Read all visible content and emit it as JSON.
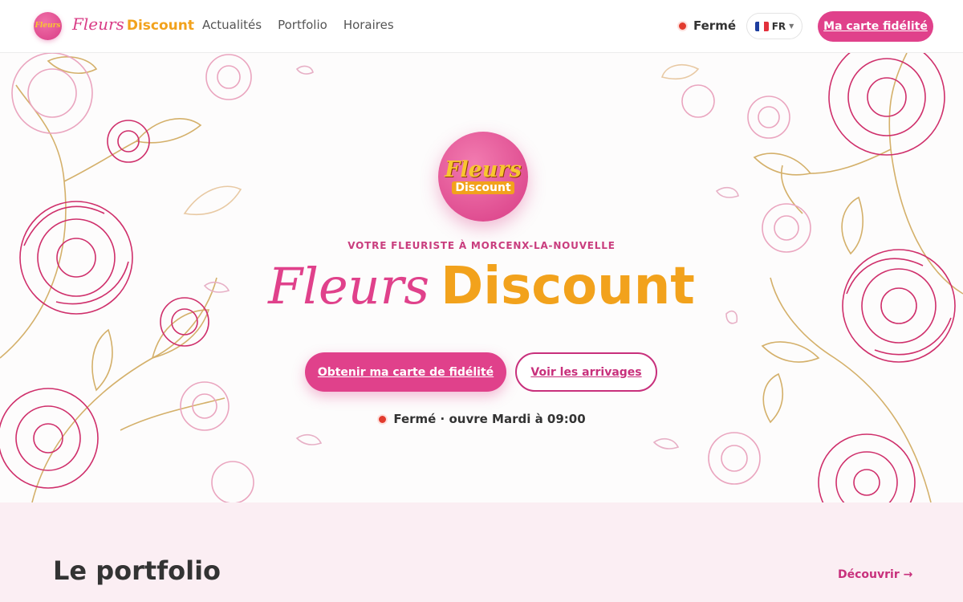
{
  "header": {
    "brand_script": "Fleurs",
    "brand_bold": "Discount",
    "logo_mini_a": "Fleurs",
    "logo_mini_b": "Discount",
    "nav": [
      "Actualités",
      "Portfolio",
      "Horaires"
    ],
    "status": "Fermé",
    "language": "FR",
    "loyalty_button": "Ma carte fidélité"
  },
  "hero": {
    "logo_script": "Fleurs",
    "logo_bold": "Discount",
    "kicker": "VOTRE FLEURISTE À MORCENX-LA-NOUVELLE",
    "title_script": "Fleurs",
    "title_bold": "Discount",
    "primary_cta": "Obtenir ma carte de fidélité",
    "secondary_cta": "Voir les arrivages",
    "status": "Fermé · ouvre Mardi à 09:00"
  },
  "portfolio": {
    "heading": "Le portfolio",
    "discover_link": "Découvrir →"
  },
  "colors": {
    "brand_pink": "#e0418b",
    "brand_orange": "#f2a21c",
    "status_red": "#e23b2e",
    "section_bg": "#fbeef3"
  },
  "icons": [
    "status-dot-icon",
    "french-flag-icon",
    "caret-down-icon",
    "arrow-right-icon"
  ]
}
